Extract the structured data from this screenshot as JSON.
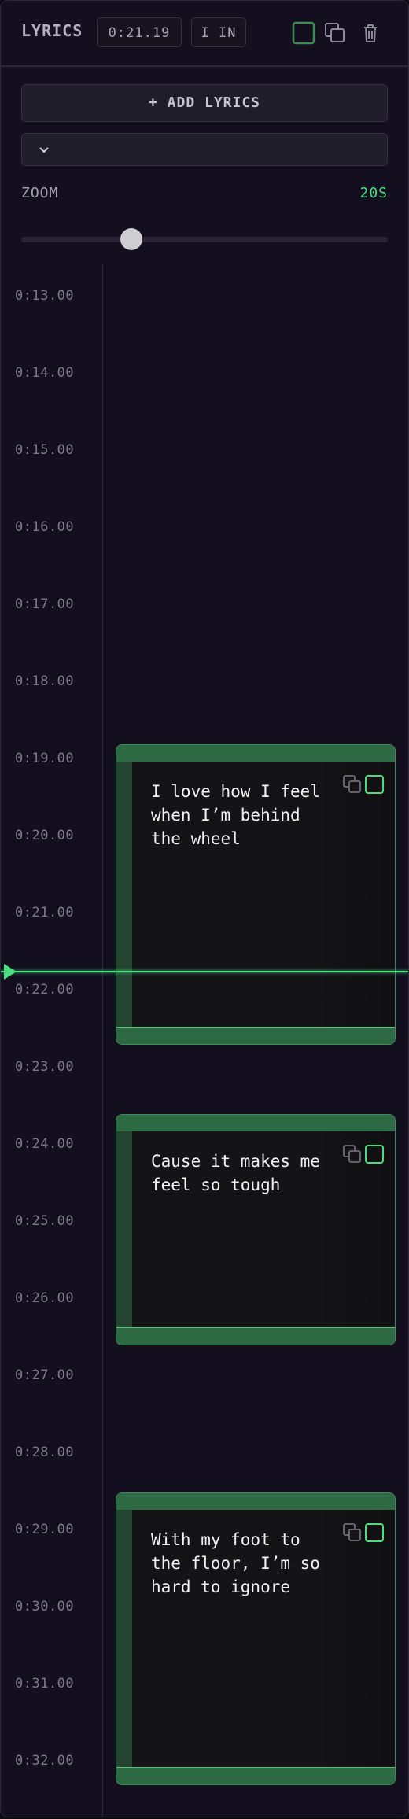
{
  "header": {
    "title": "LYRICS",
    "time": "0:21.19",
    "mode": "I IN",
    "select_icon": "checkbox-icon",
    "duplicate_icon": "copy-icon",
    "delete_icon": "trash-icon",
    "accent": "#4ade80"
  },
  "controls": {
    "add_label": "+ ADD LYRICS",
    "select_value": "",
    "zoom_label": "ZOOM",
    "zoom_value": "20S",
    "zoom_level": 0.3
  },
  "timeline": {
    "ticks": [
      "0:13.00",
      "0:14.00",
      "0:15.00",
      "0:16.00",
      "0:17.00",
      "0:18.00",
      "0:19.00",
      "0:20.00",
      "0:21.00",
      "0:22.00",
      "0:23.00",
      "0:24.00",
      "0:25.00",
      "0:26.00",
      "0:27.00",
      "0:28.00",
      "0:29.00",
      "0:30.00",
      "0:31.00",
      "0:32.00"
    ],
    "playhead_time": "0:21.19",
    "lyrics": [
      {
        "text": "I love how I feel when I’m behind the wheel",
        "start": 19.0,
        "end": 22.9
      },
      {
        "text": "Cause it makes me feel so tough",
        "start": 23.8,
        "end": 26.8
      },
      {
        "text": "With my foot to the floor, I’m so hard to ignore",
        "start": 28.7,
        "end": 32.5
      }
    ]
  }
}
